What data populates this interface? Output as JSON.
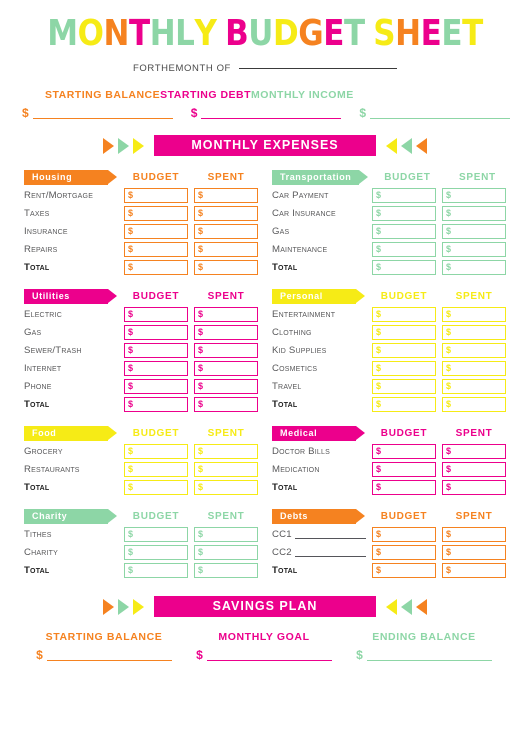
{
  "colors": {
    "orange": "#F58220",
    "magenta": "#EC008C",
    "mint": "#8DD6A6",
    "yellow": "#F6EB16",
    "dark": "#3A3A3A",
    "gray": "#58585A"
  },
  "header": {
    "title_letters": [
      {
        "ch": "M",
        "color": "#8DD6A6"
      },
      {
        "ch": "O",
        "color": "#F6EB16"
      },
      {
        "ch": "N",
        "color": "#F58220"
      },
      {
        "ch": "T",
        "color": "#EC008C"
      },
      {
        "ch": "H",
        "color": "#8DD6A6"
      },
      {
        "ch": "L",
        "color": "#8DD6A6"
      },
      {
        "ch": "Y",
        "color": "#F6EB16"
      },
      {
        "ch": " ",
        "color": "#FFFFFF"
      },
      {
        "ch": "B",
        "color": "#EC008C"
      },
      {
        "ch": "U",
        "color": "#8DD6A6"
      },
      {
        "ch": "D",
        "color": "#F6EB16"
      },
      {
        "ch": "G",
        "color": "#F58220"
      },
      {
        "ch": "E",
        "color": "#EC008C"
      },
      {
        "ch": "T",
        "color": "#8DD6A6"
      },
      {
        "ch": " ",
        "color": "#FFFFFF"
      },
      {
        "ch": "S",
        "color": "#F6EB16"
      },
      {
        "ch": "H",
        "color": "#F58220"
      },
      {
        "ch": "E",
        "color": "#EC008C"
      },
      {
        "ch": "E",
        "color": "#8DD6A6"
      },
      {
        "ch": "T",
        "color": "#F6EB16"
      }
    ],
    "title_text": "MONTHLY BUDGET SHEET",
    "for_the_month_of": "FORTHEMONTH OF",
    "month_value": ""
  },
  "top_fields": [
    {
      "label": "STARTING BALANCE",
      "color": "#F58220",
      "dollar": "$",
      "value": ""
    },
    {
      "label": "STARTING DEBT",
      "color": "#EC008C",
      "dollar": "$",
      "value": ""
    },
    {
      "label": "MONTHLY INCOME",
      "color": "#8DD6A6",
      "dollar": "$",
      "value": ""
    }
  ],
  "expenses_banner": {
    "label": "MONTHLY EXPENSES",
    "bg": "#EC008C",
    "arrows_left": [
      "#F58220",
      "#8DD6A6",
      "#F6EB16"
    ],
    "arrows_right": [
      "#F6EB16",
      "#8DD6A6",
      "#F58220"
    ]
  },
  "savings_banner": {
    "label": "SAVINGS PLAN",
    "bg": "#EC008C",
    "arrows_left": [
      "#F58220",
      "#8DD6A6",
      "#F6EB16"
    ],
    "arrows_right": [
      "#F6EB16",
      "#8DD6A6",
      "#F58220"
    ]
  },
  "column_headers": {
    "budget": "BUDGET",
    "spent": "SPENT"
  },
  "dollar_sign": "$",
  "sections": [
    {
      "name": "Housing",
      "color": "#F58220",
      "rows": [
        {
          "label": "Rent/Mortgage",
          "write_in": false,
          "total": false,
          "budget": "",
          "spent": ""
        },
        {
          "label": "Taxes",
          "write_in": false,
          "total": false,
          "budget": "",
          "spent": ""
        },
        {
          "label": "Insurance",
          "write_in": false,
          "total": false,
          "budget": "",
          "spent": ""
        },
        {
          "label": "Repairs",
          "write_in": false,
          "total": false,
          "budget": "",
          "spent": ""
        },
        {
          "label": "Total",
          "write_in": false,
          "total": true,
          "budget": "",
          "spent": ""
        }
      ]
    },
    {
      "name": "Transportation",
      "color": "#8DD6A6",
      "rows": [
        {
          "label": "Car Payment",
          "write_in": false,
          "total": false,
          "budget": "",
          "spent": ""
        },
        {
          "label": "Car Insurance",
          "write_in": false,
          "total": false,
          "budget": "",
          "spent": ""
        },
        {
          "label": "Gas",
          "write_in": false,
          "total": false,
          "budget": "",
          "spent": ""
        },
        {
          "label": "Maintenance",
          "write_in": false,
          "total": false,
          "budget": "",
          "spent": ""
        },
        {
          "label": "Total",
          "write_in": false,
          "total": true,
          "budget": "",
          "spent": ""
        }
      ]
    },
    {
      "name": "Utilities",
      "color": "#EC008C",
      "rows": [
        {
          "label": "Electric",
          "write_in": false,
          "total": false,
          "budget": "",
          "spent": ""
        },
        {
          "label": "Gas",
          "write_in": false,
          "total": false,
          "budget": "",
          "spent": ""
        },
        {
          "label": "Sewer/Trash",
          "write_in": false,
          "total": false,
          "budget": "",
          "spent": ""
        },
        {
          "label": "Internet",
          "write_in": false,
          "total": false,
          "budget": "",
          "spent": ""
        },
        {
          "label": "Phone",
          "write_in": false,
          "total": false,
          "budget": "",
          "spent": ""
        },
        {
          "label": "Total",
          "write_in": false,
          "total": true,
          "budget": "",
          "spent": ""
        }
      ]
    },
    {
      "name": "Personal",
      "color": "#F6EB16",
      "rows": [
        {
          "label": "Entertainment",
          "write_in": false,
          "total": false,
          "budget": "",
          "spent": ""
        },
        {
          "label": "Clothing",
          "write_in": false,
          "total": false,
          "budget": "",
          "spent": ""
        },
        {
          "label": "Kid Supplies",
          "write_in": false,
          "total": false,
          "budget": "",
          "spent": ""
        },
        {
          "label": "Cosmetics",
          "write_in": false,
          "total": false,
          "budget": "",
          "spent": ""
        },
        {
          "label": "Travel",
          "write_in": false,
          "total": false,
          "budget": "",
          "spent": ""
        },
        {
          "label": "Total",
          "write_in": false,
          "total": true,
          "budget": "",
          "spent": ""
        }
      ]
    },
    {
      "name": "Food",
      "color": "#F6EB16",
      "rows": [
        {
          "label": "Grocery",
          "write_in": false,
          "total": false,
          "budget": "",
          "spent": ""
        },
        {
          "label": "Restaurants",
          "write_in": false,
          "total": false,
          "budget": "",
          "spent": ""
        },
        {
          "label": "Total",
          "write_in": false,
          "total": true,
          "budget": "",
          "spent": ""
        }
      ]
    },
    {
      "name": "Medical",
      "color": "#EC008C",
      "rows": [
        {
          "label": "Doctor Bills",
          "write_in": false,
          "total": false,
          "budget": "",
          "spent": ""
        },
        {
          "label": "Medication",
          "write_in": false,
          "total": false,
          "budget": "",
          "spent": ""
        },
        {
          "label": "Total",
          "write_in": false,
          "total": true,
          "budget": "",
          "spent": ""
        }
      ]
    },
    {
      "name": "Charity",
      "color": "#8DD6A6",
      "rows": [
        {
          "label": "Tithes",
          "write_in": false,
          "total": false,
          "budget": "",
          "spent": ""
        },
        {
          "label": "Charity",
          "write_in": false,
          "total": false,
          "budget": "",
          "spent": ""
        },
        {
          "label": "Total",
          "write_in": false,
          "total": true,
          "budget": "",
          "spent": ""
        }
      ]
    },
    {
      "name": "Debts",
      "color": "#F58220",
      "rows": [
        {
          "label": "CC1",
          "write_in": true,
          "total": false,
          "budget": "",
          "spent": ""
        },
        {
          "label": "CC2",
          "write_in": true,
          "total": false,
          "budget": "",
          "spent": ""
        },
        {
          "label": "Total",
          "write_in": false,
          "total": true,
          "budget": "",
          "spent": ""
        }
      ]
    }
  ],
  "savings_fields": [
    {
      "label": "STARTING BALANCE",
      "color": "#F58220",
      "dollar": "$",
      "value": ""
    },
    {
      "label": "MONTHLY GOAL",
      "color": "#EC008C",
      "dollar": "$",
      "value": ""
    },
    {
      "label": "ENDING BALANCE",
      "color": "#8DD6A6",
      "dollar": "$",
      "value": ""
    }
  ]
}
